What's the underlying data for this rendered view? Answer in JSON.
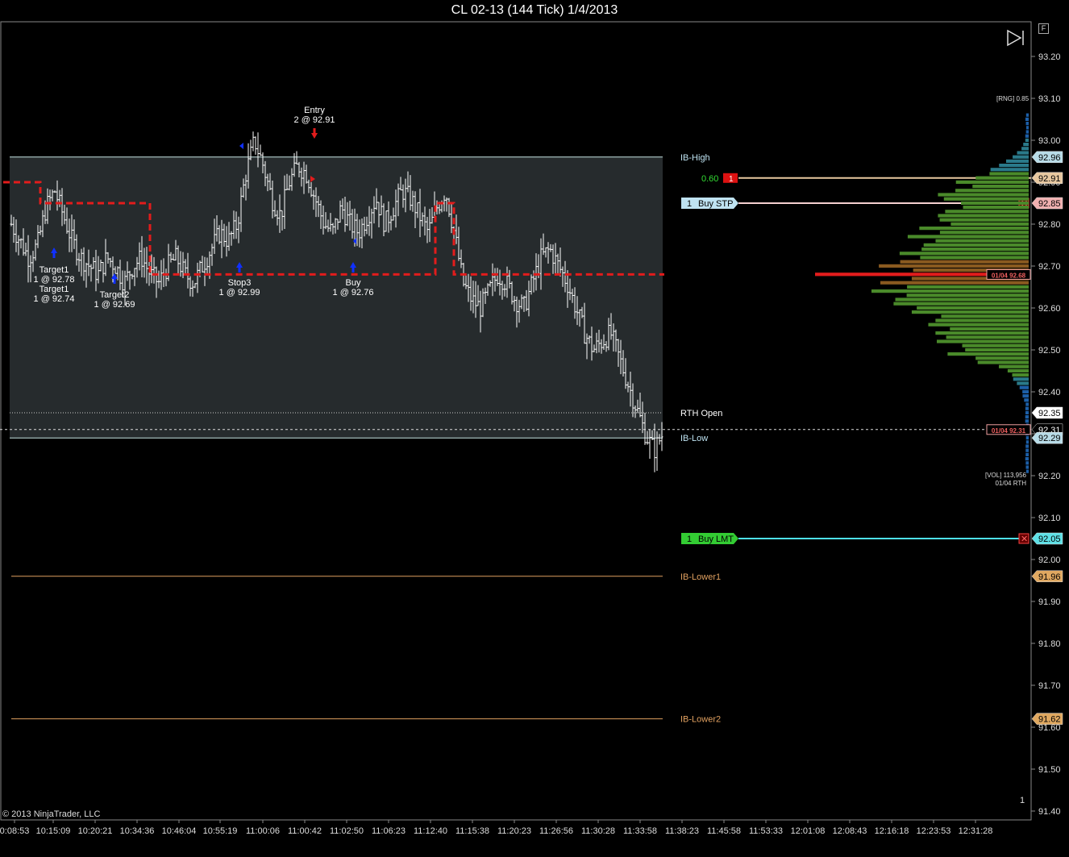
{
  "window": {
    "title": "CL 02-13 (144 Tick)  1/4/2013"
  },
  "footer": {
    "copyright": "© 2013 NinjaTrader, LLC",
    "corner_count": "1",
    "f_tag": "F"
  },
  "profile_info": {
    "range_label": "[RNG] 0.85",
    "vol_line1": "[VOL] 113,956",
    "vol_line2": "01/04 RTH"
  },
  "colors": {
    "background": "#000000",
    "ib_box": "#262b2d",
    "price_bars": "#ffffff",
    "dash_line": "#e21c1c",
    "ib_high": "#c8e6e6",
    "ib_lower": "#e0a060",
    "buy_lmt": "#33cc33",
    "buy_stp": "#bfe3f2",
    "poc": "#e21c1c"
  },
  "levels": {
    "ib_high": {
      "label": "IB-High",
      "price": 92.96
    },
    "ib_low": {
      "label": "IB-Low",
      "price": 92.29
    },
    "rth_open": {
      "label": "RTH Open",
      "price": 92.35
    },
    "ib_lower1": {
      "label": "IB-Lower1",
      "price": 91.96
    },
    "ib_lower2": {
      "label": "IB-Lower2",
      "price": 91.62
    }
  },
  "position": {
    "pnl": "0.60",
    "qty": "1",
    "price": 92.91
  },
  "orders": {
    "buy_stp": {
      "qty": "1",
      "label": "Buy STP",
      "price": 92.85
    },
    "buy_lmt": {
      "qty": "1",
      "label": "Buy LMT",
      "price": 92.05
    }
  },
  "price_axis": {
    "ticks": [
      "93.20",
      "93.10",
      "93.00",
      "92.90",
      "92.80",
      "92.70",
      "92.60",
      "92.50",
      "92.40",
      "92.30",
      "92.20",
      "92.10",
      "92.00",
      "91.90",
      "91.80",
      "91.70",
      "91.60",
      "91.50",
      "91.40"
    ],
    "markers": [
      {
        "text": "92.96",
        "price": 92.96,
        "bg": "#b8dce8",
        "fg": "#000"
      },
      {
        "text": "92.91",
        "price": 92.91,
        "bg": "#e8c8a0",
        "fg": "#000"
      },
      {
        "text": "92.85",
        "price": 92.85,
        "bg": "#f0b0b0",
        "fg": "#000"
      },
      {
        "text": "92.35",
        "price": 92.35,
        "bg": "#ffffff",
        "fg": "#000"
      },
      {
        "text": "92.31",
        "price": 92.31,
        "bg": "#000000",
        "fg": "#fff"
      },
      {
        "text": "92.29",
        "price": 92.29,
        "bg": "#b8dce8",
        "fg": "#000"
      },
      {
        "text": "92.05",
        "price": 92.05,
        "bg": "#5ee0e6",
        "fg": "#000"
      },
      {
        "text": "91.96",
        "price": 91.96,
        "bg": "#e0a860",
        "fg": "#000"
      },
      {
        "text": "91.62",
        "price": 91.62,
        "bg": "#e0a860",
        "fg": "#000"
      }
    ],
    "profile_tags": [
      {
        "text": "01/04 92.68",
        "price": 92.68
      },
      {
        "text": "01/04 92.31",
        "price": 92.31
      }
    ]
  },
  "time_axis": {
    "ticks": [
      "0:08:53",
      "10:15:09",
      "10:20:21",
      "10:34:36",
      "10:46:04",
      "10:55:19",
      "11:00:06",
      "11:00:42",
      "11:02:50",
      "11:06:23",
      "11:12:40",
      "11:15:38",
      "11:20:23",
      "11:26:56",
      "11:30:28",
      "11:33:58",
      "11:38:23",
      "11:45:58",
      "11:53:33",
      "12:01:08",
      "12:08:43",
      "12:16:18",
      "12:23:53",
      "12:31:28"
    ]
  },
  "chart_data": {
    "type": "ohlc-tick-chart",
    "instrument": "CL 02-13",
    "interval": "144 Tick",
    "date": "1/4/2013",
    "y_range": [
      91.38,
      93.24
    ],
    "close_path": [
      92.8,
      92.76,
      92.72,
      92.75,
      92.84,
      92.88,
      92.82,
      92.76,
      92.72,
      92.7,
      92.68,
      92.72,
      92.7,
      92.66,
      92.7,
      92.72,
      92.68,
      92.66,
      92.7,
      92.72,
      92.68,
      92.66,
      92.7,
      92.74,
      92.78,
      92.76,
      92.8,
      92.92,
      93.0,
      92.94,
      92.86,
      92.82,
      92.9,
      92.94,
      92.92,
      92.86,
      92.8,
      92.78,
      92.84,
      92.8,
      92.78,
      92.82,
      92.86,
      92.8,
      92.84,
      92.88,
      92.86,
      92.82,
      92.78,
      92.84,
      92.88,
      92.78,
      92.66,
      92.62,
      92.6,
      92.64,
      92.68,
      92.66,
      92.62,
      92.6,
      92.66,
      92.72,
      92.74,
      92.7,
      92.66,
      92.6,
      92.54,
      92.5,
      92.52,
      92.54,
      92.48,
      92.42,
      92.36,
      92.3,
      92.26,
      92.3
    ],
    "trade_markers": [
      {
        "label": "Entry",
        "detail": "2 @ 92.91",
        "side": "sell",
        "price": 92.91
      },
      {
        "label": "Target1",
        "detail": "1 @ 92.78",
        "side": "buy",
        "price": 92.78
      },
      {
        "label": "Target1",
        "detail": "1 @ 92.74",
        "side": "buy",
        "price": 92.74
      },
      {
        "label": "Target2",
        "detail": "1 @ 92.69",
        "side": "buy",
        "price": 92.69
      },
      {
        "label": "Stop3",
        "detail": "1 @ 92.99",
        "side": "buy",
        "price": 92.99
      },
      {
        "label": "Buy",
        "detail": "1 @ 92.76",
        "side": "buy",
        "price": 92.76
      }
    ],
    "volume_profile_poc": 92.68
  }
}
